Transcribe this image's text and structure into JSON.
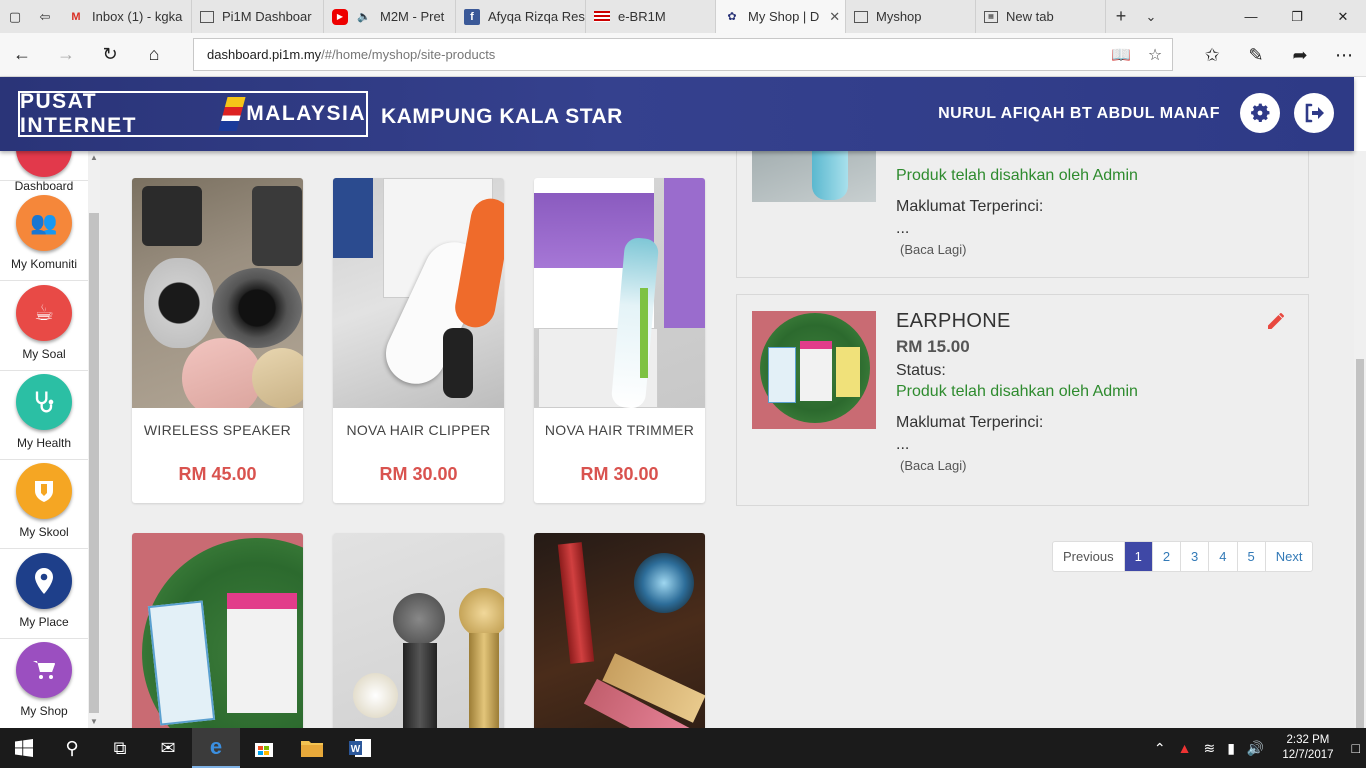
{
  "browser": {
    "tabs": [
      {
        "label": "Inbox (1) - kgka",
        "favicon": "gmail-icon",
        "active": false
      },
      {
        "label": "Pi1M Dashboar",
        "favicon": "page-icon",
        "active": false
      },
      {
        "label": "M2M - Pret",
        "favicon": "youtube-icon",
        "active": false
      },
      {
        "label": "Afyqa Rizqa Res",
        "favicon": "facebook-icon",
        "active": false
      },
      {
        "label": "e-BR1M",
        "favicon": "flag-icon",
        "active": false
      },
      {
        "label": "My Shop | D",
        "favicon": "pi1m-icon",
        "active": true
      },
      {
        "label": "Myshop",
        "favicon": "page-icon",
        "active": false
      },
      {
        "label": "New tab",
        "favicon": "newtab-icon",
        "active": false
      }
    ],
    "url_host": "dashboard.pi1m.my",
    "url_prefix": "",
    "url_path": "/#/home/myshop/site-products"
  },
  "header": {
    "logo_left": "PUSAT INTERNET",
    "logo_right": "MALAYSIA",
    "site_name": "KAMPUNG KALA STAR",
    "user_name": "NURUL AFIQAH BT ABDUL MANAF"
  },
  "sidebar": {
    "items": [
      {
        "label": "Dashboard",
        "color": "#e2394b"
      },
      {
        "label": "My Komuniti",
        "color": "#f5873a"
      },
      {
        "label": "My Soal",
        "color": "#e84a46"
      },
      {
        "label": "My Health",
        "color": "#2bbfa4"
      },
      {
        "label": "My Skool",
        "color": "#f5a623"
      },
      {
        "label": "My Place",
        "color": "#1e3f8a"
      },
      {
        "label": "My Shop",
        "color": "#9b4fc0"
      }
    ]
  },
  "products": [
    {
      "name": "WIRELESS SPEAKER",
      "price": "RM 45.00"
    },
    {
      "name": "NOVA HAIR CLIPPER",
      "price": "RM 30.00"
    },
    {
      "name": "NOVA HAIR TRIMMER",
      "price": "RM 30.00"
    }
  ],
  "list": {
    "top_panel": {
      "status_text": "Produk telah disahkan oleh Admin",
      "detail_label": "Maklumat Terperinci:",
      "detail_value": "...",
      "read_more": "(Baca Lagi)"
    },
    "panel": {
      "title": "EARPHONE",
      "price": "RM 15.00",
      "status_label": "Status:",
      "status_text": "Produk telah disahkan oleh Admin",
      "detail_label": "Maklumat Terperinci:",
      "detail_value": "...",
      "read_more": "(Baca Lagi)"
    }
  },
  "pagination": {
    "previous": "Previous",
    "pages": [
      "1",
      "2",
      "3",
      "4",
      "5"
    ],
    "next": "Next",
    "current": "1"
  },
  "taskbar": {
    "time": "2:32 PM",
    "date": "12/7/2017"
  }
}
